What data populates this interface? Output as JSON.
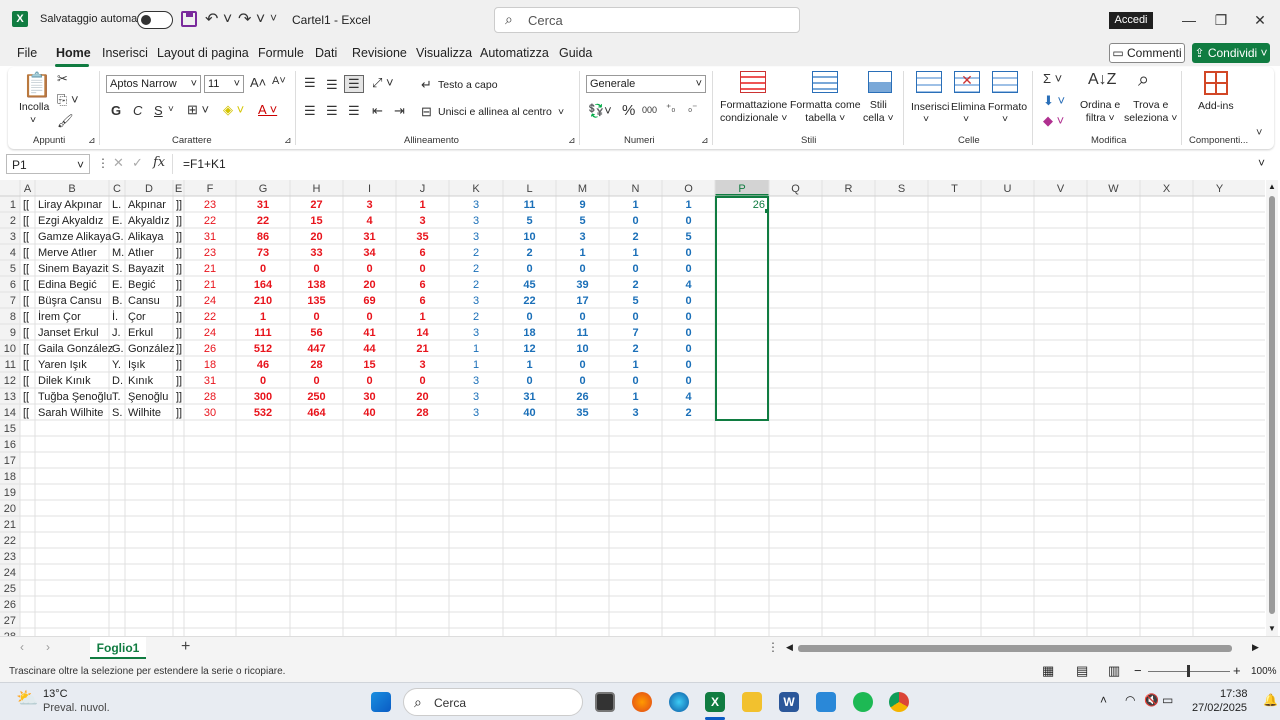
{
  "title_bar": {
    "app_logo": "X",
    "autosave_label": "Salvataggio automatico",
    "doc_title": "Cartel1 - Excel",
    "search_placeholder": "Cerca",
    "signin_label": "Accedi"
  },
  "menu": {
    "items": [
      "File",
      "Home",
      "Inserisci",
      "Layout di pagina",
      "Formule",
      "Dati",
      "Revisione",
      "Visualizza",
      "Automatizza",
      "Guida"
    ],
    "active": "Home",
    "comments_label": "Commenti",
    "share_label": "Condividi"
  },
  "ribbon": {
    "paste_label": "Incolla",
    "groups": [
      "Appunti",
      "Carattere",
      "Allineamento",
      "Numeri",
      "Stili",
      "Celle",
      "Modifica",
      "Componenti..."
    ],
    "font_name": "Aptos Narrow",
    "font_size": "11",
    "bold": "G",
    "italic": "C",
    "underline": "S",
    "wrap_text": "Testo a capo",
    "merge_center": "Unisci e allinea al centro",
    "number_format": "Generale",
    "cond_format": [
      "Formattazione",
      "condizionale"
    ],
    "format_table": [
      "Formatta come",
      "tabella"
    ],
    "cell_styles": [
      "Stili",
      "cella"
    ],
    "insert_label": "Inserisci",
    "delete_label": "Elimina",
    "format_label": "Formato",
    "sort_filter": [
      "Ordina e",
      "filtra"
    ],
    "find_select": [
      "Trova e",
      "seleziona"
    ],
    "addins": "Add-ins"
  },
  "formula_bar": {
    "name_box": "P1",
    "fx": "fx",
    "formula": "=F1+K1"
  },
  "grid": {
    "columns": [
      "A",
      "B",
      "C",
      "D",
      "E",
      "F",
      "G",
      "H",
      "I",
      "J",
      "K",
      "L",
      "M",
      "N",
      "O",
      "P",
      "Q",
      "R",
      "S",
      "T",
      "U",
      "V",
      "W",
      "X",
      "Y"
    ],
    "row_numbers": [
      "1",
      "2",
      "3",
      "4",
      "5",
      "6",
      "7",
      "8",
      "9",
      "10",
      "11",
      "12",
      "13",
      "14",
      "15",
      "16",
      "17",
      "18",
      "19",
      "20",
      "21",
      "22",
      "23",
      "24",
      "25",
      "26",
      "27",
      "28"
    ],
    "selected_column": "P",
    "colors": {
      "red": "#e8141c",
      "blue": "#1a6fb8",
      "selection": "#107c41"
    },
    "rows": [
      [
        "[[",
        "Liray Akpınar",
        "L.",
        "Akpınar",
        "]]",
        "23",
        "31",
        "27",
        "3",
        "1",
        "3",
        "11",
        "9",
        "1",
        "1",
        "26"
      ],
      [
        "[[",
        "Ezgi Akyaldız",
        "E.",
        "Akyaldız",
        "]]",
        "22",
        "22",
        "15",
        "4",
        "3",
        "3",
        "5",
        "5",
        "0",
        "0",
        ""
      ],
      [
        "[[",
        "Gamze Alikaya",
        "G.",
        "Alikaya",
        "]]",
        "31",
        "86",
        "20",
        "31",
        "35",
        "3",
        "10",
        "3",
        "2",
        "5",
        ""
      ],
      [
        "[[",
        "Merve Atlıer",
        "M.",
        "Atlıer",
        "]]",
        "23",
        "73",
        "33",
        "34",
        "6",
        "2",
        "2",
        "1",
        "1",
        "0",
        ""
      ],
      [
        "[[",
        "Sinem Bayazit",
        "S.",
        "Bayazit",
        "]]",
        "21",
        "0",
        "0",
        "0",
        "0",
        "2",
        "0",
        "0",
        "0",
        "0",
        ""
      ],
      [
        "[[",
        "Edina Begić",
        "E.",
        "Begić",
        "]]",
        "21",
        "164",
        "138",
        "20",
        "6",
        "2",
        "45",
        "39",
        "2",
        "4",
        ""
      ],
      [
        "[[",
        "Büşra Cansu",
        "B.",
        "Cansu",
        "]]",
        "24",
        "210",
        "135",
        "69",
        "6",
        "3",
        "22",
        "17",
        "5",
        "0",
        ""
      ],
      [
        "[[",
        "İrem Çor",
        "İ.",
        "Çor",
        "]]",
        "22",
        "1",
        "0",
        "0",
        "1",
        "2",
        "0",
        "0",
        "0",
        "0",
        ""
      ],
      [
        "[[",
        "Janset Erkul",
        "J.",
        "Erkul",
        "]]",
        "24",
        "111",
        "56",
        "41",
        "14",
        "3",
        "18",
        "11",
        "7",
        "0",
        ""
      ],
      [
        "[[",
        "Gaila González",
        "G.",
        "González",
        "]]",
        "26",
        "512",
        "447",
        "44",
        "21",
        "1",
        "12",
        "10",
        "2",
        "0",
        ""
      ],
      [
        "[[",
        "Yaren Işık",
        "Y.",
        "Işık",
        "]]",
        "18",
        "46",
        "28",
        "15",
        "3",
        "1",
        "1",
        "0",
        "1",
        "0",
        ""
      ],
      [
        "[[",
        "Dilek Kınık",
        "D.",
        "Kınık",
        "]]",
        "31",
        "0",
        "0",
        "0",
        "0",
        "3",
        "0",
        "0",
        "0",
        "0",
        ""
      ],
      [
        "[[",
        "Tuğba Şenoğlu",
        "T.",
        "Şenoğlu",
        "]]",
        "28",
        "300",
        "250",
        "30",
        "20",
        "3",
        "31",
        "26",
        "1",
        "4",
        ""
      ],
      [
        "[[",
        "Sarah Wilhite",
        "S.",
        "Wilhite",
        "]]",
        "30",
        "532",
        "464",
        "40",
        "28",
        "3",
        "40",
        "35",
        "3",
        "2",
        ""
      ]
    ]
  },
  "sheet_tabs": {
    "active": "Foglio1",
    "add": "+"
  },
  "status_bar": {
    "message": "Trascinare oltre la selezione per estendere la serie o ricopiare.",
    "zoom": "100%"
  },
  "taskbar": {
    "weather_temp": "13°C",
    "weather_desc": "Preval. nuvol.",
    "search_label": "Cerca",
    "time": "17:38",
    "date": "27/02/2025"
  }
}
